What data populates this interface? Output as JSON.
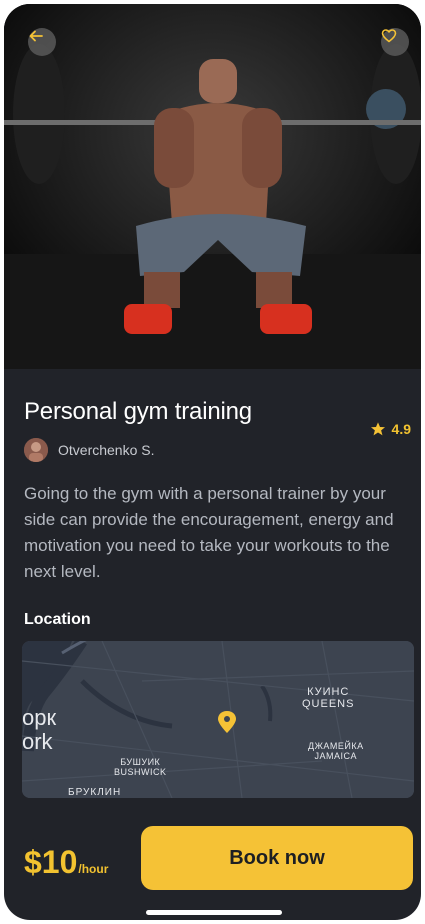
{
  "hero": {
    "back_icon": "arrow-left-icon",
    "favorite_icon": "heart-icon"
  },
  "listing": {
    "title": "Personal gym training",
    "rating": "4.9",
    "rating_icon": "star-icon",
    "author": "Otverchenko S.",
    "description": "Going to the gym with a personal trainer by your side can provide the encouragement, energy and motivation you need to take your workouts to the next level."
  },
  "location": {
    "heading": "Location",
    "labels": {
      "queens_ru": "КУИНС",
      "queens": "QUEENS",
      "jamaica_ru": "ДЖАМЕЙКА",
      "jamaica": "JAMAICA",
      "bushwick_ru": "БУШУИК",
      "bushwick": "BUSHWICK",
      "brooklyn_ru": "БРУКЛИН",
      "york_ru": "орк",
      "york": "ork"
    }
  },
  "footer": {
    "price": "$10",
    "unit": "/hour",
    "cta": "Book now"
  },
  "colors": {
    "accent": "#f5c236",
    "background": "#212329",
    "map": "#3d4450"
  }
}
